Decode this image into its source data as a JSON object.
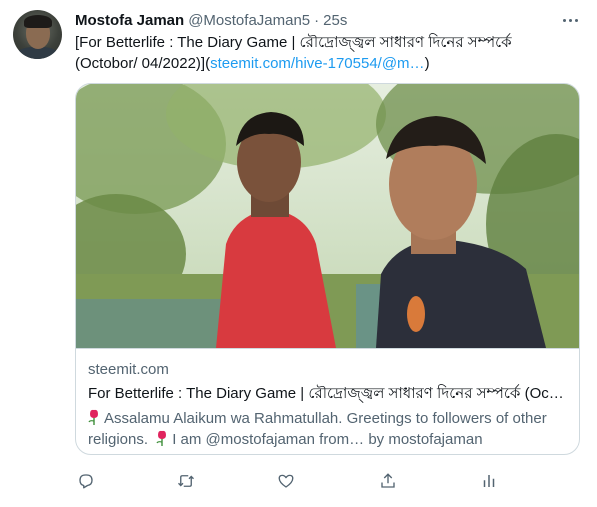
{
  "author": {
    "name": "Mostofa Jaman",
    "handle": "@MostofaJaman5",
    "separator": "·",
    "time": "25s",
    "avatar_icon": "user-avatar"
  },
  "tweet": {
    "text_line1": "[For Betterlife : The Diary Game | রৌদ্রোজ্জ্বল সাধারণ দিনের  সম্পর্কে",
    "text_line2_prefix": "(Octobor/ 04/2022)](",
    "text_link": "steemit.com/hive-170554/@m…",
    "text_line2_suffix": ")"
  },
  "card": {
    "domain": "steemit.com",
    "title": "For Betterlife : The Diary Game | রৌদ্রোজ্জ্বল সাধারণ দিনের সম্পর্কে (Oc…",
    "desc_part1": "Assalamu Alaikum wa Rahmatullah. Greetings to followers of other religions.",
    "desc_part2": "I am @mostofajaman from… by mostofajaman",
    "image_icon": "selfie-photo"
  },
  "actions": {
    "icons": [
      "reply-icon",
      "retweet-icon",
      "like-icon",
      "share-icon",
      "analytics-icon"
    ]
  },
  "colors": {
    "link": "#1d9bf0",
    "secondary_text": "#536471",
    "border": "#cfd9de",
    "primary_text": "#0f1419"
  }
}
